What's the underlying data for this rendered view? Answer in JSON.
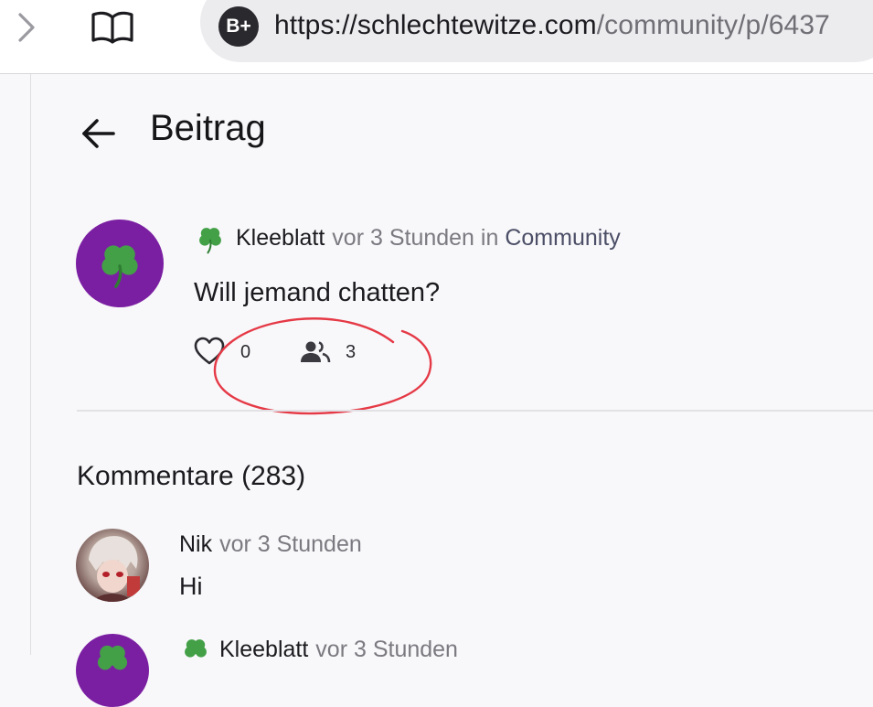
{
  "browser": {
    "badge": "B+",
    "url_host": "https://schlechtewitze.com",
    "url_path": "/community/p/6437"
  },
  "page": {
    "title": "Beitrag"
  },
  "post": {
    "author": "Kleeblatt",
    "time": "vor 3 Stunden",
    "in_word": "in",
    "community": "Community",
    "text": "Will jemand chatten?",
    "likes": "0",
    "participants": "3"
  },
  "comments": {
    "heading": "Kommentare (283)",
    "items": [
      {
        "author": "Nik",
        "time": "vor 3 Stunden",
        "text": "Hi"
      },
      {
        "author": "Kleeblatt",
        "time": "vor 3 Stunden"
      }
    ]
  },
  "colors": {
    "avatar_purple": "#7b1fa2",
    "clover_green": "#43a047",
    "annotation_red": "#e53946"
  }
}
